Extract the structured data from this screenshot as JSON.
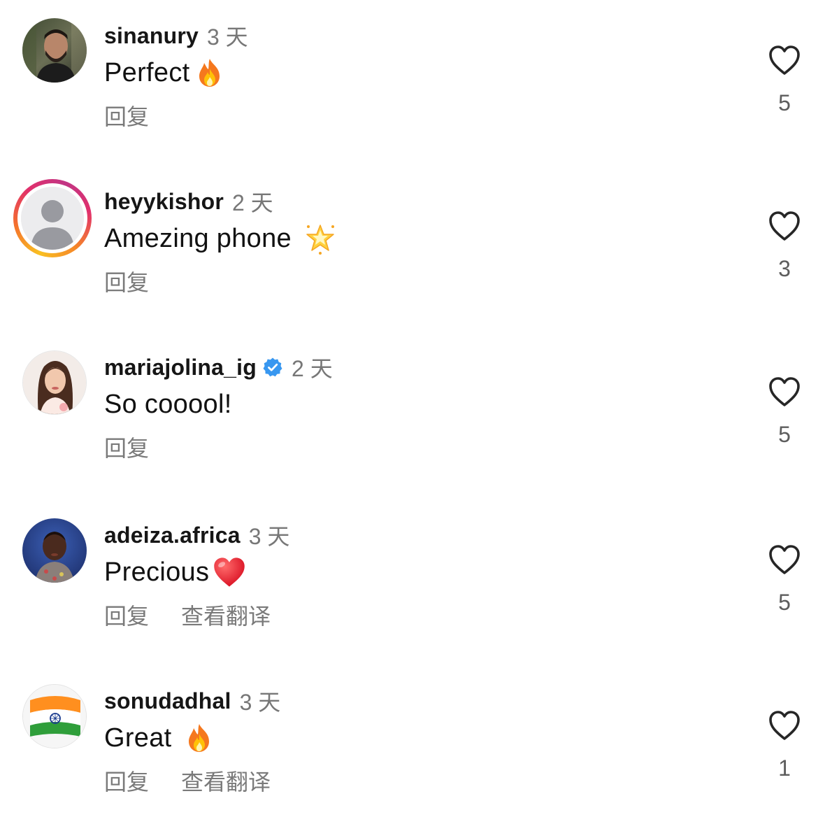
{
  "actions": {
    "reply_label": "回复",
    "translate_label": "查看翻译"
  },
  "colors": {
    "username": "#161616",
    "secondary_text": "#777777",
    "verified_badge": "#3897f0",
    "like_icon": "#262626"
  },
  "comments": [
    {
      "username": "sinanury",
      "time": "3 天",
      "text": "Perfect",
      "emoji": "fire-emoji",
      "likes": "5",
      "avatar": "man-portrait-avatar",
      "verified": false
    },
    {
      "username": "heyykishor",
      "time": "2 天",
      "text": "Amezing phone",
      "emoji": "glowing-star-emoji",
      "likes": "3",
      "avatar": "default-profile-avatar-with-story-ring",
      "verified": false
    },
    {
      "username": "mariajolina_ig",
      "time": "2 天",
      "text": "So cooool!",
      "emoji": "",
      "likes": "5",
      "avatar": "woman-portrait-avatar",
      "verified": true
    },
    {
      "username": "adeiza.africa",
      "time": "3 天",
      "text": "Precious",
      "emoji": "red-heart-emoji",
      "likes": "5",
      "avatar": "child-portrait-avatar",
      "verified": false
    },
    {
      "username": "sonudadhal",
      "time": "3 天",
      "text": "Great",
      "emoji": "fire-emoji",
      "likes": "1",
      "avatar": "india-flag-avatar",
      "verified": false
    }
  ]
}
